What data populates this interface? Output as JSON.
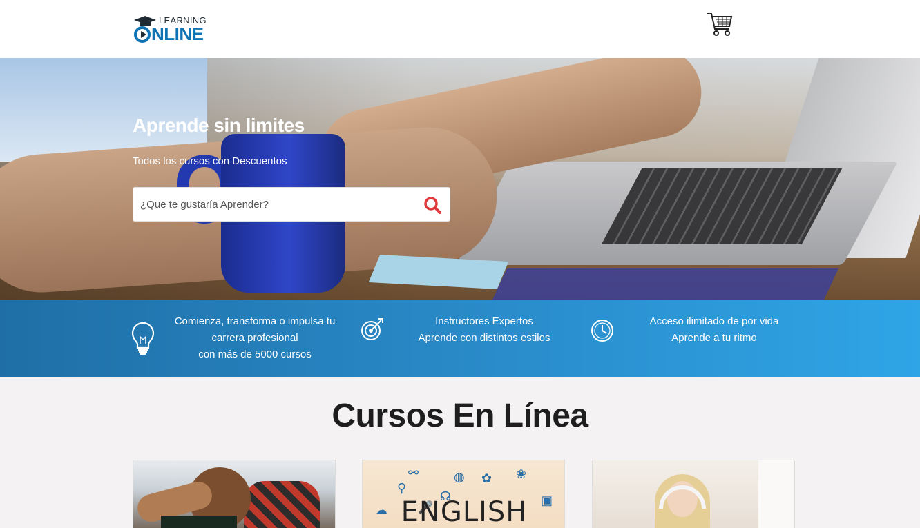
{
  "header": {
    "logo_learning": "LEARNING",
    "logo_online": "NLINE",
    "cart_icon": "shopping-cart-icon"
  },
  "hero": {
    "title": "Aprende sin limites",
    "subtitle": "Todos los cursos con Descuentos",
    "search": {
      "placeholder": "¿Que te gustaría Aprender?",
      "value": "",
      "icon": "search-icon",
      "icon_color": "#e03a3e"
    }
  },
  "features": [
    {
      "icon": "lightbulb-icon",
      "lines": [
        "Comienza, transforma o impulsa tu",
        "carrera profesional",
        "con más de 5000 cursos"
      ]
    },
    {
      "icon": "target-icon",
      "lines": [
        "Instructores Expertos",
        "Aprende con distintos estilos"
      ]
    },
    {
      "icon": "clock-icon",
      "lines": [
        "Acceso ilimitado de por vida",
        "Aprende a tu ritmo"
      ]
    }
  ],
  "courses": {
    "title": "Cursos En Línea",
    "cards": [
      {
        "image": "kid-robotics-image"
      },
      {
        "image": "english-doodles-image",
        "image_text": "ENGLISH"
      },
      {
        "image": "girl-headphones-image"
      }
    ]
  },
  "colors": {
    "brand_blue": "#1074b4",
    "features_gradient_start": "#1f6fa6",
    "features_gradient_end": "#2fa5e6",
    "search_icon": "#e03a3e"
  }
}
